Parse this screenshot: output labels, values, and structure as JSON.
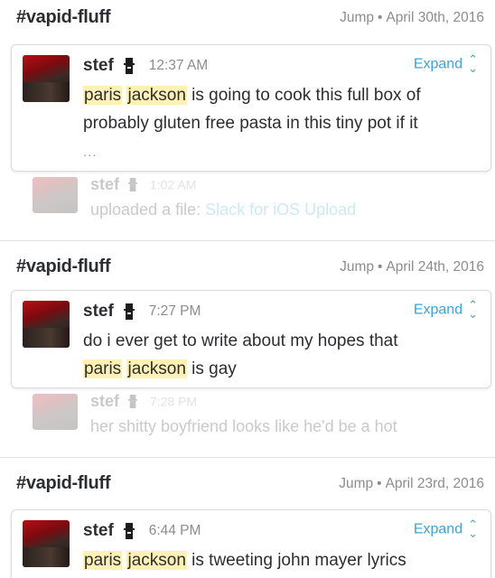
{
  "common": {
    "jump_label": "Jump",
    "separator": "•",
    "expand_label": "Expand",
    "expand_icon": "⌃⌄",
    "ellipsis": "..."
  },
  "groups": [
    {
      "channel": "#vapid-fluff",
      "date": "April 30th, 2016",
      "message": {
        "sender": "stef",
        "time": "12:37 AM",
        "hl1": "paris",
        "hl2": "jackson",
        "line1_rest": " is going to cook this full box of",
        "line2": "probably gluten free pasta in this tiny pot if it"
      },
      "context": {
        "sender": "stef",
        "time": "1:02 AM",
        "prefix": "uploaded a file: ",
        "link": "Slack for iOS Upload"
      }
    },
    {
      "channel": "#vapid-fluff",
      "date": "April 24th, 2016",
      "message": {
        "sender": "stef",
        "time": "7:27 PM",
        "line1": "do i ever get to write about my hopes that",
        "hl1": "paris",
        "hl2": "jackson",
        "line2_rest": " is gay"
      },
      "context": {
        "sender": "stef",
        "time": "7:28 PM",
        "text": "her shitty boyfriend looks like he'd be a hot"
      }
    },
    {
      "channel": "#vapid-fluff",
      "date": "April 23rd, 2016",
      "message": {
        "sender": "stef",
        "time": "6:44 PM",
        "hl1": "paris",
        "hl2": "jackson",
        "line1_rest": " is tweeting john mayer lyrics"
      }
    }
  ],
  "colors": {
    "link": "#3aa3e3",
    "highlight": "#fdf1b4",
    "muted": "#8b8c8f",
    "text": "#2c2d30"
  }
}
